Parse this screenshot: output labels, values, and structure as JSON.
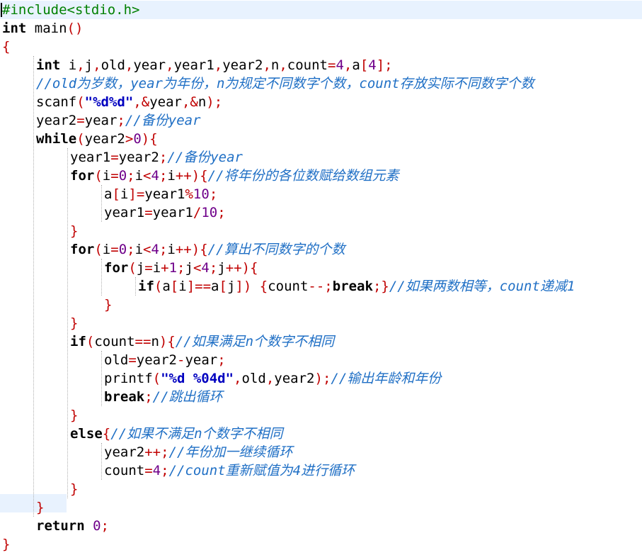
{
  "editor": {
    "lines": [
      {
        "indent": 0,
        "tokens": [
          [
            "pp",
            "#include<stdio.h>"
          ]
        ],
        "highlight": true
      },
      {
        "indent": 0,
        "tokens": [
          [
            "kw",
            "int"
          ],
          [
            "t",
            " main"
          ],
          [
            "br",
            "()"
          ]
        ]
      },
      {
        "indent": 0,
        "tokens": [
          [
            "br",
            "{"
          ]
        ]
      },
      {
        "indent": 1,
        "tokens": [
          [
            "kw",
            "int"
          ],
          [
            "t",
            " i"
          ],
          [
            "op",
            ","
          ],
          [
            "t",
            "j"
          ],
          [
            "op",
            ","
          ],
          [
            "t",
            "old"
          ],
          [
            "op",
            ","
          ],
          [
            "t",
            "year"
          ],
          [
            "op",
            ","
          ],
          [
            "t",
            "year1"
          ],
          [
            "op",
            ","
          ],
          [
            "t",
            "year2"
          ],
          [
            "op",
            ","
          ],
          [
            "t",
            "n"
          ],
          [
            "op",
            ","
          ],
          [
            "t",
            "count"
          ],
          [
            "op",
            "="
          ],
          [
            "num",
            "4"
          ],
          [
            "op",
            ","
          ],
          [
            "t",
            "a"
          ],
          [
            "br",
            "["
          ],
          [
            "num",
            "4"
          ],
          [
            "br",
            "]"
          ],
          [
            "op",
            ";"
          ]
        ]
      },
      {
        "indent": 1,
        "tokens": [
          [
            "cmt",
            "//old为岁数，year为年份，n为规定不同数字个数，count存放实际不同数字个数"
          ]
        ]
      },
      {
        "indent": 1,
        "tokens": [
          [
            "t",
            "scanf"
          ],
          [
            "br",
            "("
          ],
          [
            "str",
            "\"%d%d\""
          ],
          [
            "op",
            ",&"
          ],
          [
            "t",
            "year"
          ],
          [
            "op",
            ",&"
          ],
          [
            "t",
            "n"
          ],
          [
            "br",
            ")"
          ],
          [
            "op",
            ";"
          ]
        ]
      },
      {
        "indent": 1,
        "tokens": [
          [
            "t",
            "year2"
          ],
          [
            "op",
            "="
          ],
          [
            "t",
            "year"
          ],
          [
            "op",
            ";"
          ],
          [
            "cmt",
            "//备份year"
          ]
        ]
      },
      {
        "indent": 1,
        "tokens": [
          [
            "kw",
            "while"
          ],
          [
            "br",
            "("
          ],
          [
            "t",
            "year2"
          ],
          [
            "op",
            ">"
          ],
          [
            "num",
            "0"
          ],
          [
            "br",
            "){"
          ]
        ]
      },
      {
        "indent": 2,
        "tokens": [
          [
            "t",
            "year1"
          ],
          [
            "op",
            "="
          ],
          [
            "t",
            "year2"
          ],
          [
            "op",
            ";"
          ],
          [
            "cmt",
            "//备份year"
          ]
        ]
      },
      {
        "indent": 2,
        "tokens": [
          [
            "kw",
            "for"
          ],
          [
            "br",
            "("
          ],
          [
            "t",
            "i"
          ],
          [
            "op",
            "="
          ],
          [
            "num",
            "0"
          ],
          [
            "op",
            ";"
          ],
          [
            "t",
            "i"
          ],
          [
            "op",
            "<"
          ],
          [
            "num",
            "4"
          ],
          [
            "op",
            ";"
          ],
          [
            "t",
            "i"
          ],
          [
            "op",
            "++"
          ],
          [
            "br",
            "){"
          ],
          [
            "cmt",
            "//将年份的各位数赋给数组元素"
          ]
        ]
      },
      {
        "indent": 3,
        "tokens": [
          [
            "t",
            "a"
          ],
          [
            "br",
            "["
          ],
          [
            "t",
            "i"
          ],
          [
            "br",
            "]"
          ],
          [
            "op",
            "="
          ],
          [
            "t",
            "year1"
          ],
          [
            "op",
            "%"
          ],
          [
            "num",
            "10"
          ],
          [
            "op",
            ";"
          ]
        ]
      },
      {
        "indent": 3,
        "tokens": [
          [
            "t",
            "year1"
          ],
          [
            "op",
            "="
          ],
          [
            "t",
            "year1"
          ],
          [
            "op",
            "/"
          ],
          [
            "num",
            "10"
          ],
          [
            "op",
            ";"
          ]
        ]
      },
      {
        "indent": 2,
        "tokens": [
          [
            "br",
            "}"
          ]
        ]
      },
      {
        "indent": 2,
        "tokens": [
          [
            "kw",
            "for"
          ],
          [
            "br",
            "("
          ],
          [
            "t",
            "i"
          ],
          [
            "op",
            "="
          ],
          [
            "num",
            "0"
          ],
          [
            "op",
            ";"
          ],
          [
            "t",
            "i"
          ],
          [
            "op",
            "<"
          ],
          [
            "num",
            "4"
          ],
          [
            "op",
            ";"
          ],
          [
            "t",
            "i"
          ],
          [
            "op",
            "++"
          ],
          [
            "br",
            "){"
          ],
          [
            "cmt",
            "//算出不同数字的个数"
          ]
        ]
      },
      {
        "indent": 3,
        "tokens": [
          [
            "kw",
            "for"
          ],
          [
            "br",
            "("
          ],
          [
            "t",
            "j"
          ],
          [
            "op",
            "="
          ],
          [
            "t",
            "i"
          ],
          [
            "op",
            "+"
          ],
          [
            "num",
            "1"
          ],
          [
            "op",
            ";"
          ],
          [
            "t",
            "j"
          ],
          [
            "op",
            "<"
          ],
          [
            "num",
            "4"
          ],
          [
            "op",
            ";"
          ],
          [
            "t",
            "j"
          ],
          [
            "op",
            "++"
          ],
          [
            "br",
            "){"
          ]
        ]
      },
      {
        "indent": 4,
        "tokens": [
          [
            "kw",
            "if"
          ],
          [
            "br",
            "("
          ],
          [
            "t",
            "a"
          ],
          [
            "br",
            "["
          ],
          [
            "t",
            "i"
          ],
          [
            "br",
            "]"
          ],
          [
            "op",
            "=="
          ],
          [
            "t",
            "a"
          ],
          [
            "br",
            "["
          ],
          [
            "t",
            "j"
          ],
          [
            "br",
            "])"
          ],
          [
            "t",
            " "
          ],
          [
            "br",
            "{"
          ],
          [
            "t",
            "count"
          ],
          [
            "op",
            "--;"
          ],
          [
            "kw",
            "break"
          ],
          [
            "op",
            ";"
          ],
          [
            "br",
            "}"
          ],
          [
            "cmt",
            "//如果两数相等，count递减1"
          ]
        ]
      },
      {
        "indent": 3,
        "tokens": [
          [
            "br",
            "}"
          ]
        ]
      },
      {
        "indent": 2,
        "tokens": [
          [
            "br",
            "}"
          ]
        ]
      },
      {
        "indent": 2,
        "tokens": [
          [
            "kw",
            "if"
          ],
          [
            "br",
            "("
          ],
          [
            "t",
            "count"
          ],
          [
            "op",
            "=="
          ],
          [
            "t",
            "n"
          ],
          [
            "br",
            "){"
          ],
          [
            "cmt",
            "//如果满足n个数字不相同"
          ]
        ]
      },
      {
        "indent": 3,
        "tokens": [
          [
            "t",
            "old"
          ],
          [
            "op",
            "="
          ],
          [
            "t",
            "year2"
          ],
          [
            "op",
            "-"
          ],
          [
            "t",
            "year"
          ],
          [
            "op",
            ";"
          ]
        ]
      },
      {
        "indent": 3,
        "tokens": [
          [
            "t",
            "printf"
          ],
          [
            "br",
            "("
          ],
          [
            "str",
            "\"%d %04d\""
          ],
          [
            "op",
            ","
          ],
          [
            "t",
            "old"
          ],
          [
            "op",
            ","
          ],
          [
            "t",
            "year2"
          ],
          [
            "br",
            ")"
          ],
          [
            "op",
            ";"
          ],
          [
            "cmt",
            "//输出年龄和年份"
          ]
        ]
      },
      {
        "indent": 3,
        "tokens": [
          [
            "kw",
            "break"
          ],
          [
            "op",
            ";"
          ],
          [
            "cmt",
            "//跳出循环"
          ]
        ]
      },
      {
        "indent": 2,
        "tokens": [
          [
            "br",
            "}"
          ]
        ]
      },
      {
        "indent": 2,
        "tokens": [
          [
            "kw",
            "else"
          ],
          [
            "br",
            "{"
          ],
          [
            "cmt",
            "//如果不满足n个数字不相同"
          ]
        ]
      },
      {
        "indent": 3,
        "tokens": [
          [
            "t",
            "year2"
          ],
          [
            "op",
            "++;"
          ],
          [
            "cmt",
            "//年份加一继续循环"
          ]
        ]
      },
      {
        "indent": 3,
        "tokens": [
          [
            "t",
            "count"
          ],
          [
            "op",
            "="
          ],
          [
            "num",
            "4"
          ],
          [
            "op",
            ";"
          ],
          [
            "cmt",
            "//count重新赋值为4进行循环"
          ]
        ]
      },
      {
        "indent": 2,
        "tokens": [
          [
            "br",
            "}"
          ]
        ]
      },
      {
        "indent": 1,
        "tokens": [
          [
            "br",
            "}"
          ]
        ]
      },
      {
        "indent": 1,
        "tokens": [
          [
            "kw",
            "return"
          ],
          [
            "t",
            " "
          ],
          [
            "num",
            "0"
          ],
          [
            "op",
            ";"
          ]
        ]
      },
      {
        "indent": 0,
        "tokens": [
          [
            "br",
            "}"
          ]
        ]
      }
    ]
  }
}
